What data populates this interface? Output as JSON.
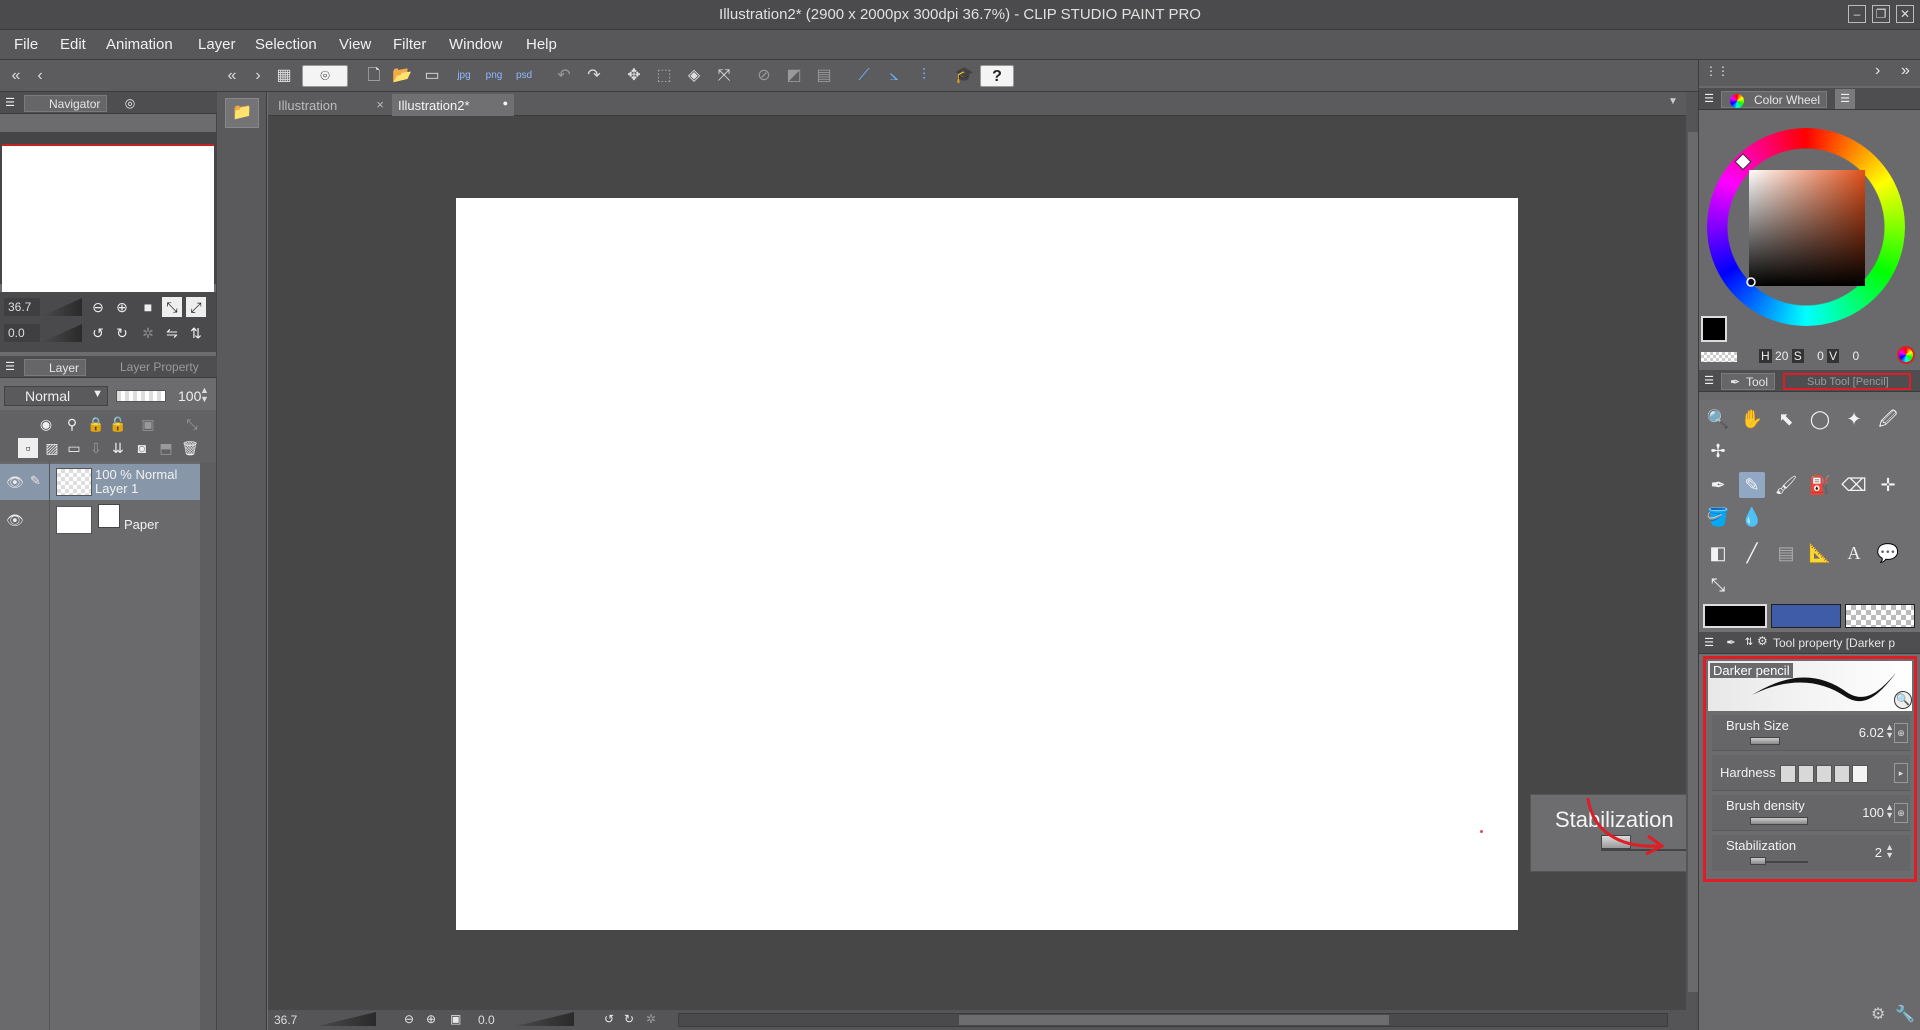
{
  "window": {
    "title": "Illustration2* (2900 x 2000px 300dpi 36.7%)  - CLIP STUDIO PAINT PRO",
    "controls": [
      "–",
      "❐",
      "✕"
    ]
  },
  "menu": [
    "File",
    "Edit",
    "Animation",
    "Layer",
    "Selection",
    "View",
    "Filter",
    "Window",
    "Help"
  ],
  "toolbar": {
    "help_label": "?",
    "jpg_label": "jpg",
    "png_label": "png",
    "psd_label": "psd"
  },
  "navigator": {
    "tab_label": "Navigator",
    "zoom_value": "36.7",
    "rotate_value": "0.0"
  },
  "layer_panel": {
    "tab_layer": "Layer",
    "tab_property": "Layer Property",
    "blend_mode": "Normal",
    "opacity": "100",
    "layers": [
      {
        "line1": "100 % Normal",
        "line2": "Layer 1",
        "selected": true
      },
      {
        "line1": "",
        "line2": "Paper",
        "selected": false
      }
    ]
  },
  "document_tabs": [
    {
      "label": "Illustration",
      "active": false,
      "close": "×"
    },
    {
      "label": "Illustration2*",
      "active": true,
      "close": "●"
    }
  ],
  "stabilization_popup": {
    "label": "Stabilization",
    "value": "2",
    "level": 0.2
  },
  "status_bar": {
    "zoom": "36.7",
    "rotation": "0.0"
  },
  "color_panel": {
    "tab_label": "Color Wheel",
    "h_label": "H",
    "h_value": "20",
    "s_label": "S",
    "s_value": "0",
    "v_label": "V",
    "v_value": "0"
  },
  "tool_panel": {
    "tab_tool": "Tool",
    "tab_subtool": "Sub Tool [Pencil]"
  },
  "colors": {
    "main": "#000000",
    "sub": "#3f5ca8",
    "highlight": "#e01c24"
  },
  "tool_property": {
    "header": "Tool property [Darker p",
    "brush_name": "Darker pencil",
    "brush_size_label": "Brush Size",
    "brush_size_value": "6.02",
    "hardness_label": "Hardness",
    "density_label": "Brush density",
    "density_value": "100",
    "stabilization_label": "Stabilization",
    "stabilization_value": "2"
  }
}
